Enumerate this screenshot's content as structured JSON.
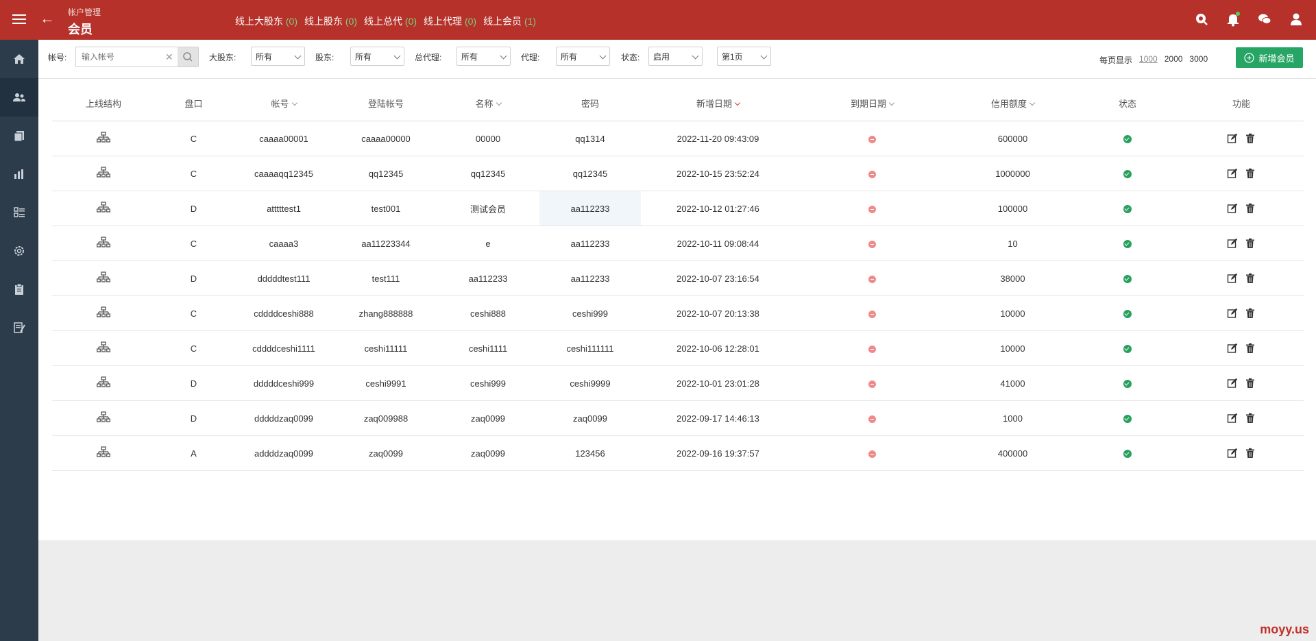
{
  "header": {
    "breadcrumb": "帐户管理",
    "title": "会员",
    "online": [
      {
        "label": "线上大股东",
        "count": "(0)"
      },
      {
        "label": "线上股东",
        "count": "(0)"
      },
      {
        "label": "线上总代",
        "count": "(0)"
      },
      {
        "label": "线上代理",
        "count": "(0)"
      },
      {
        "label": "线上会员",
        "count": "(1)"
      }
    ],
    "icons": [
      "search-globe-icon",
      "bell-icon",
      "chat-icon",
      "user-icon"
    ]
  },
  "sidebar": {
    "items": [
      "home-icon",
      "users-icon",
      "documents-icon",
      "chart-icon",
      "list-icon",
      "settings-icon",
      "clipboard-icon",
      "report-icon"
    ]
  },
  "filters": {
    "account_label": "帐号:",
    "account_placeholder": "输入帐号",
    "major_shareholder_label": "大股东:",
    "major_shareholder_value": "所有",
    "shareholder_label": "股东:",
    "shareholder_value": "所有",
    "general_agent_label": "总代理:",
    "general_agent_value": "所有",
    "agent_label": "代理:",
    "agent_value": "所有",
    "status_label": "状态:",
    "status_value": "启用",
    "page_value": "第1页",
    "per_page_label": "每页显示",
    "per_page_options": [
      "1000",
      "2000",
      "3000"
    ],
    "add_button": "新增会员"
  },
  "table": {
    "headers": [
      "上线结构",
      "盘口",
      "帐号",
      "登陆帐号",
      "名称",
      "密码",
      "新增日期",
      "到期日期",
      "信用额度",
      "状态",
      "功能"
    ],
    "rows": [
      {
        "plate": "C",
        "account": "caaaa00001",
        "login": "caaaa00000",
        "name": "00000",
        "password": "qq1314",
        "created": "2022-11-20 09:43:09",
        "credit": "600000"
      },
      {
        "plate": "C",
        "account": "caaaaqq12345",
        "login": "qq12345",
        "name": "qq12345",
        "password": "qq12345",
        "created": "2022-10-15 23:52:24",
        "credit": "1000000"
      },
      {
        "plate": "D",
        "account": "atttttest1",
        "login": "test001",
        "name": "测试会员",
        "password": "aa112233",
        "created": "2022-10-12 01:27:46",
        "credit": "100000"
      },
      {
        "plate": "C",
        "account": "caaaa3",
        "login": "aa11223344",
        "name": "e",
        "password": "aa112233",
        "created": "2022-10-11 09:08:44",
        "credit": "10"
      },
      {
        "plate": "D",
        "account": "dddddtest111",
        "login": "test111",
        "name": "aa112233",
        "password": "aa112233",
        "created": "2022-10-07 23:16:54",
        "credit": "38000"
      },
      {
        "plate": "C",
        "account": "cddddceshi888",
        "login": "zhang888888",
        "name": "ceshi888",
        "password": "ceshi999",
        "created": "2022-10-07 20:13:38",
        "credit": "10000"
      },
      {
        "plate": "C",
        "account": "cddddceshi1111",
        "login": "ceshi11111",
        "name": "ceshi1111",
        "password": "ceshi111111",
        "created": "2022-10-06 12:28:01",
        "credit": "10000"
      },
      {
        "plate": "D",
        "account": "dddddceshi999",
        "login": "ceshi9991",
        "name": "ceshi999",
        "password": "ceshi9999",
        "created": "2022-10-01 23:01:28",
        "credit": "41000"
      },
      {
        "plate": "D",
        "account": "dddddzaq0099",
        "login": "zaq009988",
        "name": "zaq0099",
        "password": "zaq0099",
        "created": "2022-09-17 14:46:13",
        "credit": "1000"
      },
      {
        "plate": "A",
        "account": "addddzaq0099",
        "login": "zaq0099",
        "name": "zaq0099",
        "password": "123456",
        "created": "2022-09-16 19:37:57",
        "credit": "400000"
      }
    ]
  },
  "watermark": "moyy.us",
  "colors": {
    "topbar": "#b5312a",
    "sidebar": "#2c3c4a",
    "add_button": "#27a565",
    "online_count": "#7fd07f"
  }
}
